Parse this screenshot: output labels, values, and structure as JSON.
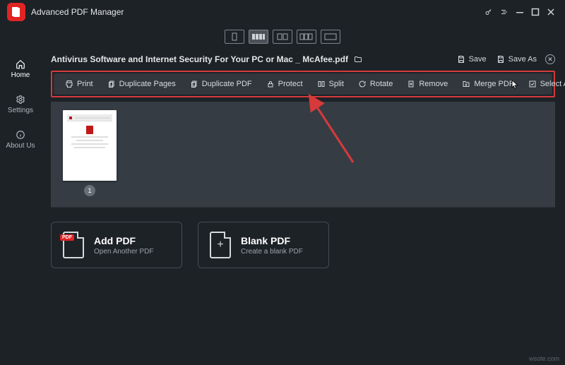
{
  "app": {
    "title": "Advanced PDF Manager"
  },
  "sidebar": {
    "items": [
      {
        "label": "Home"
      },
      {
        "label": "Settings"
      },
      {
        "label": "About Us"
      }
    ]
  },
  "file": {
    "name": "Antivirus Software and Internet Security For Your PC or Mac _ McAfee.pdf",
    "save_label": "Save",
    "save_as_label": "Save As"
  },
  "toolbar": {
    "print": "Print",
    "duplicate_pages": "Duplicate Pages",
    "duplicate_pdf": "Duplicate PDF",
    "protect": "Protect",
    "split": "Split",
    "rotate": "Rotate",
    "remove": "Remove",
    "merge_pdf": "Merge PDF",
    "select_all": "Select All"
  },
  "pages": [
    {
      "number": "1"
    }
  ],
  "cards": {
    "add": {
      "title": "Add PDF",
      "subtitle": "Open Another PDF"
    },
    "blank": {
      "title": "Blank PDF",
      "subtitle": "Create a blank PDF"
    }
  },
  "watermark": "wsote.com"
}
